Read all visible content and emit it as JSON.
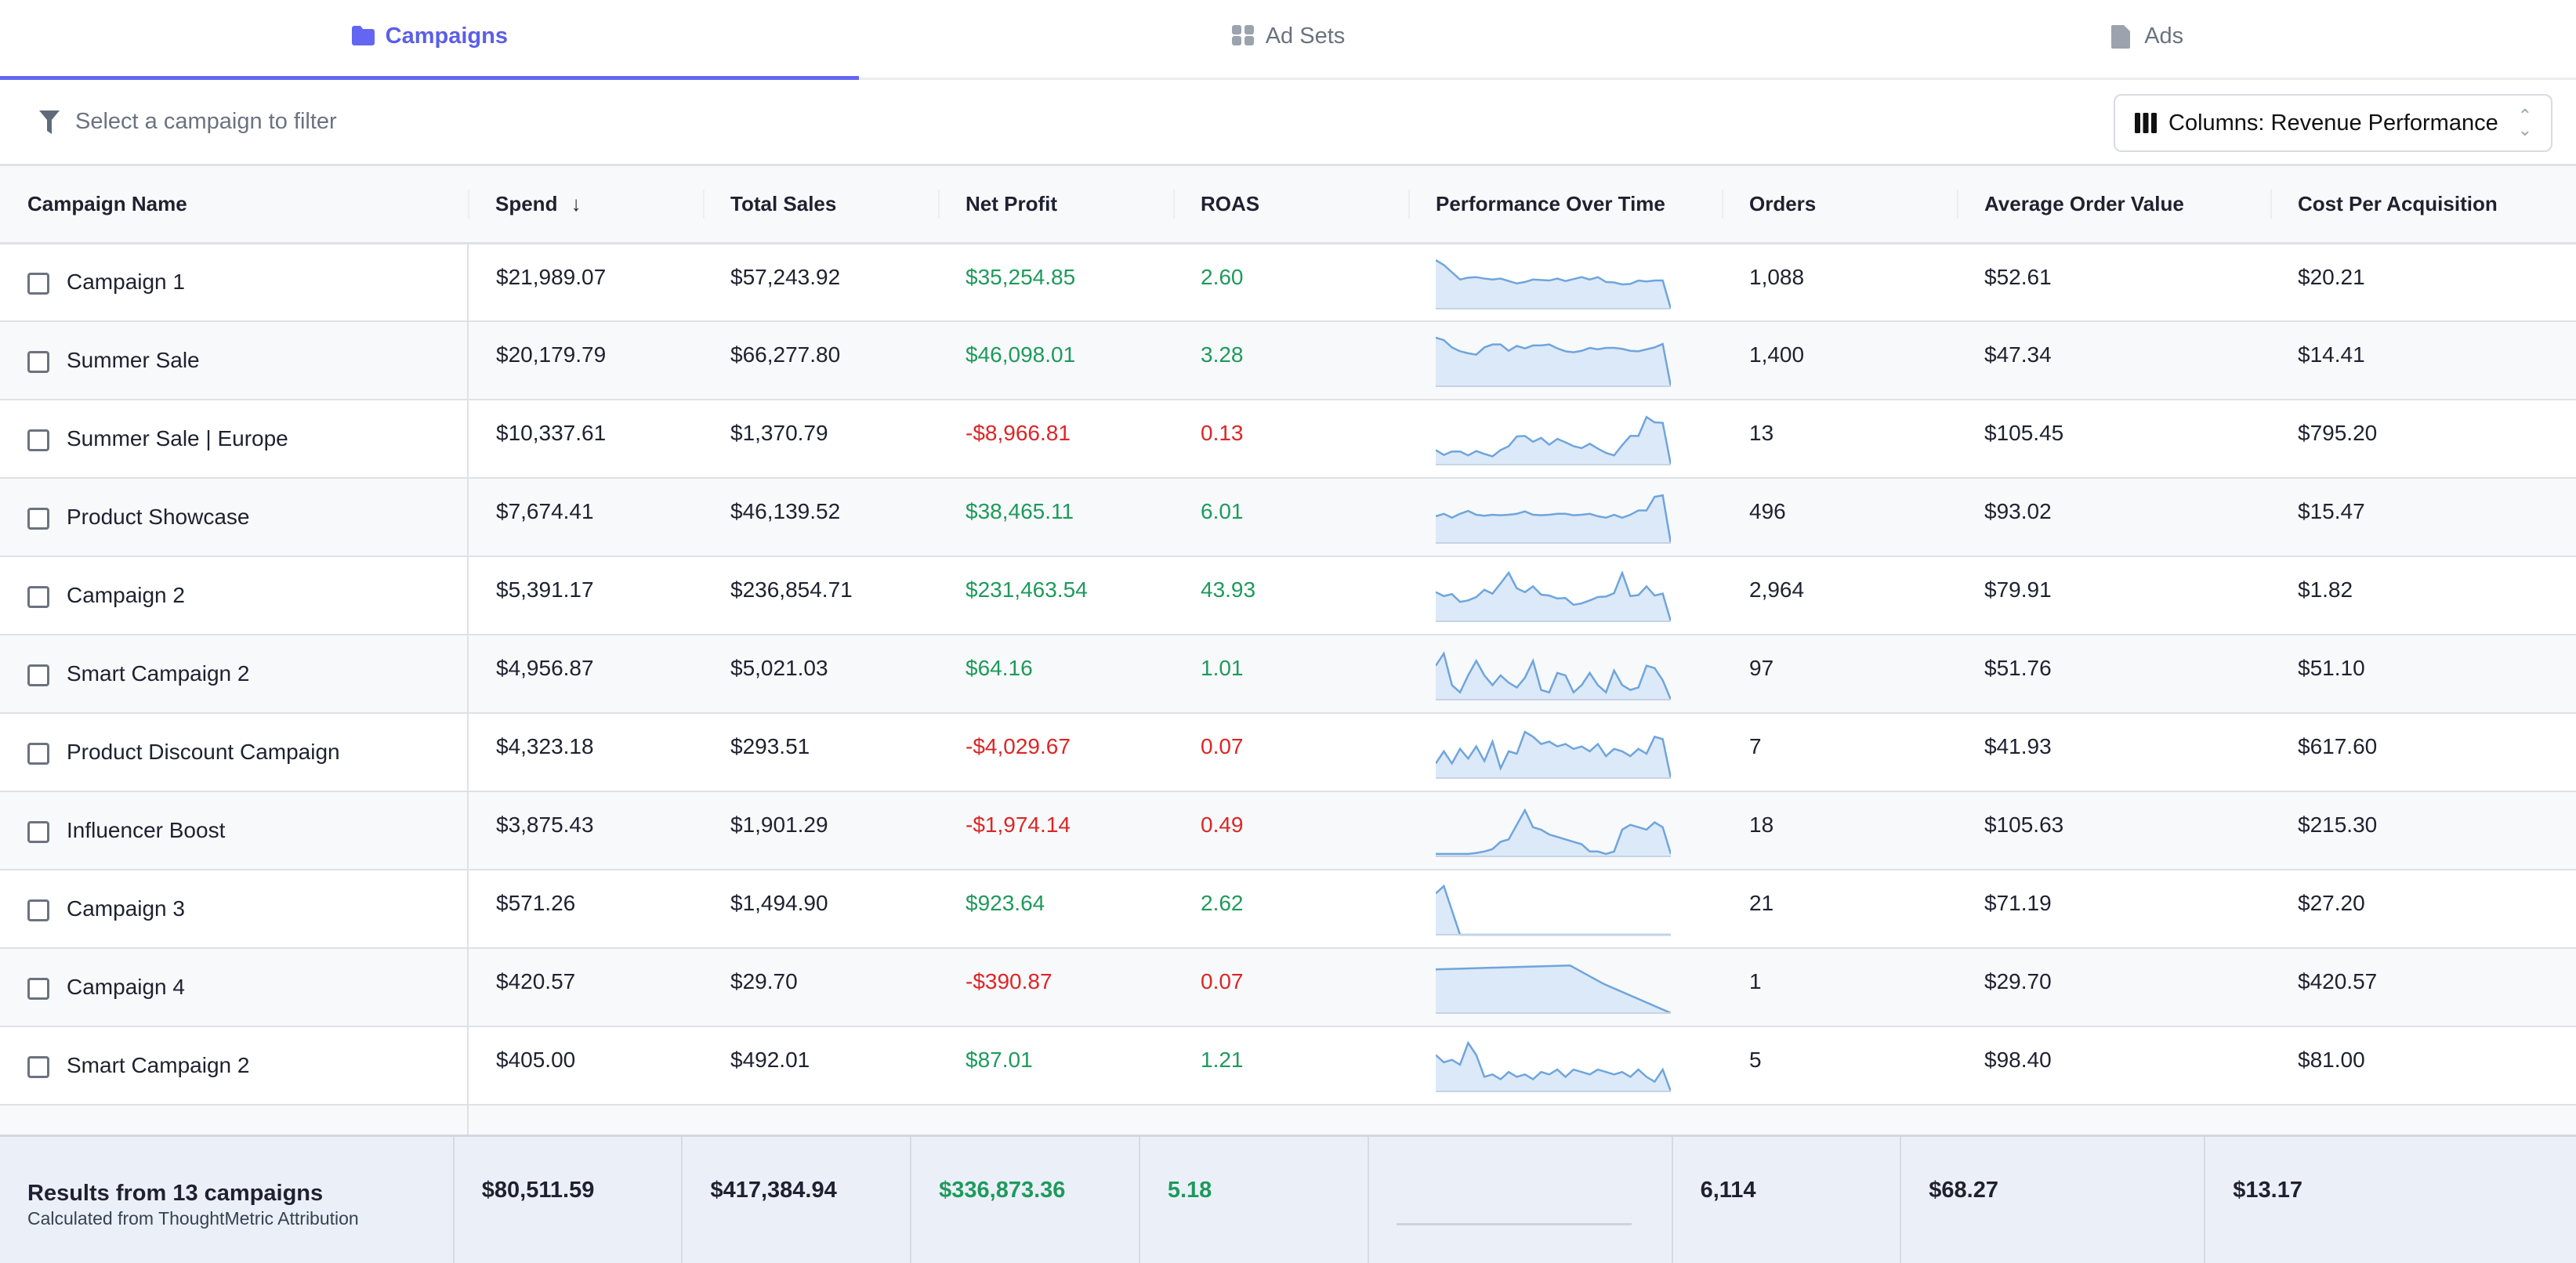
{
  "tabs": [
    {
      "label": "Campaigns",
      "icon": "folder-icon",
      "active": true
    },
    {
      "label": "Ad Sets",
      "icon": "grid-icon",
      "active": false
    },
    {
      "label": "Ads",
      "icon": "file-icon",
      "active": false
    }
  ],
  "filter": {
    "placeholder": "Select a campaign to filter",
    "icon": "filter-icon"
  },
  "column_selector": {
    "label": "Columns: Revenue Performance",
    "icon": "columns-icon"
  },
  "colors": {
    "accent": "#6366f1",
    "positive": "#1e9a5c",
    "negative": "#dc2626",
    "spark_line": "#6fa5dc",
    "spark_fill": "#dce9f8"
  },
  "columns": [
    "Campaign Name",
    "Spend",
    "Total Sales",
    "Net Profit",
    "ROAS",
    "Performance Over Time",
    "Orders",
    "Average Order Value",
    "Cost Per Acquisition"
  ],
  "sort": {
    "column": "Spend",
    "direction": "desc",
    "icon": "arrow-down-icon"
  },
  "rows": [
    {
      "name": "Campaign 1",
      "spend": "$21,989.07",
      "sales": "$57,243.92",
      "profit": "$35,254.85",
      "roas": "2.60",
      "positive": true,
      "orders": "1,088",
      "aov": "$52.61",
      "cpa": "$20.21",
      "trend": [
        1,
        0.9,
        0.75,
        0.6,
        0.64,
        0.65,
        0.62,
        0.6,
        0.62,
        0.57,
        0.52,
        0.55,
        0.6,
        0.59,
        0.58,
        0.62,
        0.57,
        0.61,
        0.65,
        0.6,
        0.65,
        0.55,
        0.54,
        0.5,
        0.51,
        0.58,
        0.56,
        0.58,
        0.58,
        0
      ]
    },
    {
      "name": "Summer Sale",
      "spend": "$20,179.79",
      "sales": "$66,277.80",
      "profit": "$46,098.01",
      "roas": "3.28",
      "positive": true,
      "orders": "1,400",
      "aov": "$47.34",
      "cpa": "$14.41",
      "trend": [
        1,
        0.95,
        0.8,
        0.72,
        0.68,
        0.65,
        0.8,
        0.86,
        0.86,
        0.73,
        0.83,
        0.78,
        0.84,
        0.84,
        0.86,
        0.78,
        0.72,
        0.7,
        0.73,
        0.79,
        0.76,
        0.79,
        0.79,
        0.77,
        0.73,
        0.72,
        0.76,
        0.8,
        0.87,
        0
      ]
    },
    {
      "name": "Summer Sale | Europe",
      "spend": "$10,337.61",
      "sales": "$1,370.79",
      "profit": "-$8,966.81",
      "roas": "0.13",
      "positive": false,
      "orders": "13",
      "aov": "$105.45",
      "cpa": "$795.20",
      "trend": [
        0.3,
        0.2,
        0.27,
        0.27,
        0.19,
        0.28,
        0.22,
        0.17,
        0.3,
        0.38,
        0.58,
        0.59,
        0.47,
        0.55,
        0.41,
        0.53,
        0.46,
        0.38,
        0.34,
        0.43,
        0.33,
        0.24,
        0.19,
        0.4,
        0.59,
        0.59,
        0.98,
        0.87,
        0.86,
        0
      ]
    },
    {
      "name": "Product Showcase",
      "spend": "$7,674.41",
      "sales": "$46,139.52",
      "profit": "$38,465.11",
      "roas": "6.01",
      "positive": true,
      "orders": "496",
      "aov": "$93.02",
      "cpa": "$15.47",
      "trend": [
        0.55,
        0.6,
        0.52,
        0.6,
        0.66,
        0.58,
        0.56,
        0.58,
        0.57,
        0.58,
        0.6,
        0.65,
        0.58,
        0.57,
        0.58,
        0.6,
        0.6,
        0.57,
        0.58,
        0.6,
        0.55,
        0.52,
        0.58,
        0.52,
        0.58,
        0.67,
        0.67,
        0.95,
        0.98,
        0
      ]
    },
    {
      "name": "Campaign 2",
      "spend": "$5,391.17",
      "sales": "$236,854.71",
      "profit": "$231,463.54",
      "roas": "43.93",
      "positive": true,
      "orders": "2,964",
      "aov": "$79.91",
      "cpa": "$1.82",
      "trend": [
        0.6,
        0.52,
        0.56,
        0.4,
        0.43,
        0.5,
        0.65,
        0.57,
        0.78,
        1,
        0.68,
        0.6,
        0.72,
        0.55,
        0.53,
        0.47,
        0.48,
        0.34,
        0.37,
        0.43,
        0.5,
        0.51,
        0.58,
        1,
        0.52,
        0.54,
        0.72,
        0.53,
        0.57,
        0
      ]
    },
    {
      "name": "Smart Campaign 2",
      "spend": "$4,956.87",
      "sales": "$5,021.03",
      "profit": "$64.16",
      "roas": "1.01",
      "positive": true,
      "orders": "97",
      "aov": "$51.76",
      "cpa": "$51.10",
      "trend": [
        0.7,
        0.95,
        0.3,
        0.15,
        0.5,
        0.8,
        0.5,
        0.3,
        0.5,
        0.35,
        0.25,
        0.45,
        0.8,
        0.2,
        0.15,
        0.55,
        0.5,
        0.15,
        0.3,
        0.55,
        0.3,
        0.15,
        0.6,
        0.3,
        0.2,
        0.25,
        0.7,
        0.65,
        0.4,
        0
      ]
    },
    {
      "name": "Product Discount Campaign",
      "spend": "$4,323.18",
      "sales": "$293.51",
      "profit": "-$4,029.67",
      "roas": "0.07",
      "positive": false,
      "orders": "7",
      "aov": "$41.93",
      "cpa": "$617.60",
      "trend": [
        0.3,
        0.55,
        0.3,
        0.6,
        0.4,
        0.65,
        0.35,
        0.75,
        0.2,
        0.55,
        0.5,
        0.95,
        0.85,
        0.7,
        0.75,
        0.65,
        0.7,
        0.6,
        0.65,
        0.55,
        0.7,
        0.45,
        0.6,
        0.55,
        0.45,
        0.6,
        0.5,
        0.85,
        0.8,
        0
      ]
    },
    {
      "name": "Influencer Boost",
      "spend": "$3,875.43",
      "sales": "$1,901.29",
      "profit": "-$1,974.14",
      "roas": "0.49",
      "positive": false,
      "orders": "18",
      "aov": "$105.63",
      "cpa": "$215.30",
      "trend": [
        0.05,
        0.05,
        0.05,
        0.05,
        0.05,
        0.07,
        0.1,
        0.15,
        0.3,
        0.35,
        0.65,
        0.95,
        0.6,
        0.55,
        0.45,
        0.4,
        0.35,
        0.3,
        0.25,
        0.1,
        0.1,
        0.05,
        0.1,
        0.55,
        0.65,
        0.6,
        0.55,
        0.7,
        0.6,
        0.05
      ]
    },
    {
      "name": "Campaign 3",
      "spend": "$571.26",
      "sales": "$1,494.90",
      "profit": "$923.64",
      "roas": "2.62",
      "positive": true,
      "orders": "21",
      "aov": "$71.19",
      "cpa": "$27.20",
      "trend": [
        0.85,
        1,
        0.5,
        0,
        0,
        0,
        0,
        0,
        0,
        0,
        0,
        0,
        0,
        0,
        0,
        0,
        0,
        0,
        0,
        0,
        0,
        0,
        0,
        0,
        0,
        0,
        0,
        0,
        0,
        0
      ]
    },
    {
      "name": "Campaign 4",
      "spend": "$420.57",
      "sales": "$29.70",
      "profit": "-$390.87",
      "roas": "0.07",
      "positive": false,
      "orders": "1",
      "aov": "$29.70",
      "cpa": "$420.57",
      "trend": [
        0.9,
        0.92,
        0.94,
        0.96,
        0.98,
        0.6,
        0.3,
        0
      ]
    },
    {
      "name": "Smart Campaign 2",
      "spend": "$405.00",
      "sales": "$492.01",
      "profit": "$87.01",
      "roas": "1.21",
      "positive": true,
      "orders": "5",
      "aov": "$98.40",
      "cpa": "$81.00",
      "trend": [
        0.75,
        0.6,
        0.65,
        0.55,
        1,
        0.75,
        0.3,
        0.35,
        0.25,
        0.4,
        0.3,
        0.35,
        0.25,
        0.4,
        0.35,
        0.45,
        0.3,
        0.45,
        0.4,
        0.35,
        0.45,
        0.4,
        0.35,
        0.4,
        0.3,
        0.45,
        0.3,
        0.2,
        0.45,
        0
      ]
    }
  ],
  "totals": {
    "title": "Results from 13 campaigns",
    "subtitle": "Calculated from ThoughtMetric Attribution",
    "spend": "$80,511.59",
    "sales": "$417,384.94",
    "profit": "$336,873.36",
    "roas": "5.18",
    "orders": "6,114",
    "aov": "$68.27",
    "cpa": "$13.17"
  }
}
